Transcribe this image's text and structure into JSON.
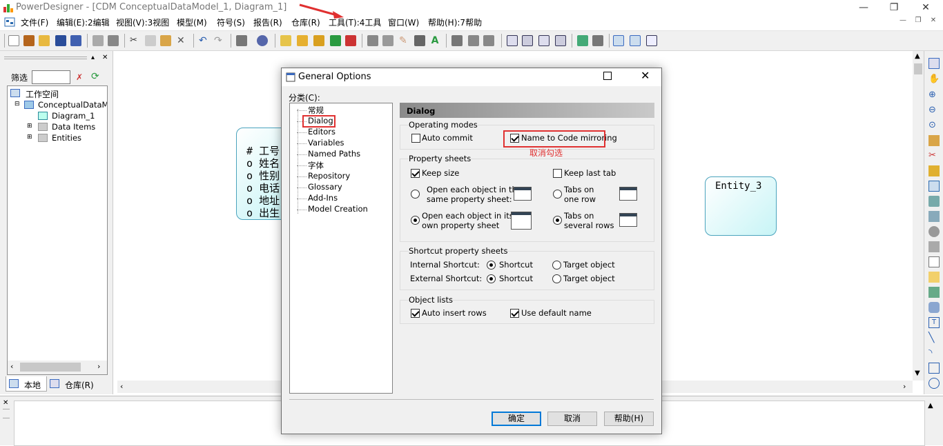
{
  "window": {
    "title": "PowerDesigner - [CDM ConceptualDataModel_1, Diagram_1]",
    "minimize": "—",
    "maximize": "❐",
    "close": "✕"
  },
  "menu": [
    "文件(F)",
    "编辑(E):2编辑",
    "视图(V):3视图",
    "模型(M)",
    "符号(S)",
    "报告(R)",
    "仓库(R)",
    "工具(T):4工具",
    "窗口(W)",
    "帮助(H):7帮助"
  ],
  "left_panel": {
    "filter_label": "筛选",
    "tree": {
      "workspace": "工作空间",
      "model": "ConceptualDataMod",
      "diagram": "Diagram_1",
      "data_items": "Data Items",
      "entities": "Entities"
    },
    "tabs": [
      "本地",
      "仓库(R)"
    ]
  },
  "canvas": {
    "entity1_rows": [
      {
        "marker": "#",
        "text": "工号"
      },
      {
        "marker": "o",
        "text": "姓名"
      },
      {
        "marker": "o",
        "text": "性别"
      },
      {
        "marker": "o",
        "text": "电话"
      },
      {
        "marker": "o",
        "text": "地址"
      },
      {
        "marker": "o",
        "text": "出生"
      }
    ],
    "entity3_name": "Entity_3"
  },
  "dialog": {
    "title": "General Options",
    "category_label": "分类(C):",
    "categories": [
      "常规",
      "Dialog",
      "Editors",
      "Variables",
      "Named Paths",
      "字体",
      "Repository",
      "Glossary",
      "Add-Ins",
      "Model Creation"
    ],
    "selected_category": "Dialog",
    "panel_header": "Dialog",
    "operating_modes": {
      "title": "Operating modes",
      "auto_commit": "Auto commit",
      "auto_commit_checked": false,
      "name_to_code": "Name to Code mirroring",
      "name_to_code_checked": true
    },
    "annotation": "取消勾选",
    "property_sheets": {
      "title": "Property sheets",
      "keep_size": "Keep size",
      "keep_size_checked": true,
      "keep_last_tab": "Keep last tab",
      "keep_last_tab_checked": false,
      "open_same_1": "Open each object in the",
      "open_same_2": "same property sheet:",
      "open_own_1": "Open each object in its",
      "open_own_2": "own property sheet",
      "tabs_one_1": "Tabs on",
      "tabs_one_2": "one row",
      "tabs_several_1": "Tabs on",
      "tabs_several_2": "several rows"
    },
    "shortcut": {
      "title": "Shortcut property sheets",
      "internal": "Internal Shortcut:",
      "external": "External Shortcut:",
      "shortcut": "Shortcut",
      "target": "Target object"
    },
    "object_lists": {
      "title": "Object lists",
      "auto_insert": "Auto insert rows",
      "use_default": "Use default name"
    },
    "buttons": {
      "ok": "确定",
      "cancel": "取消",
      "help": "帮助(H)"
    }
  },
  "colors": {
    "annotation_red": "#e03030",
    "entity_border": "#4aa3bd",
    "entity_fill": "#c7f4f6"
  }
}
